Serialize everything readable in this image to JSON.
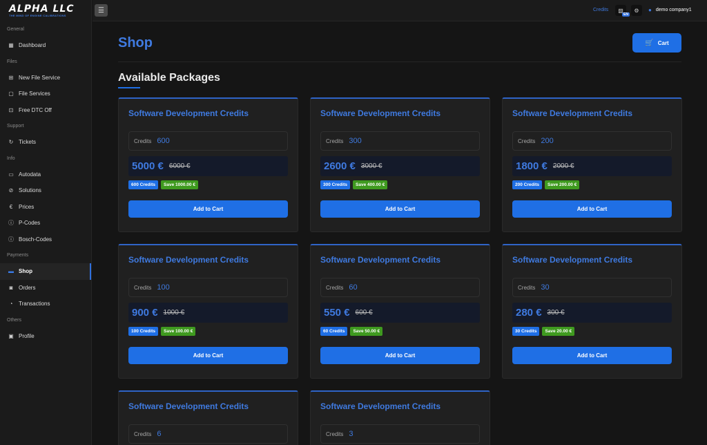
{
  "brand": {
    "name": "ALPHA LLC",
    "tagline": "THE MIND OF ENGINE CALIBRATIONS"
  },
  "topbar": {
    "menu_icon": "menu-icon",
    "credits_label": "Credits",
    "language": "EN",
    "user_name": "demo company1"
  },
  "sidebar": {
    "sections": [
      {
        "title": "General",
        "items": [
          {
            "label": "Dashboard",
            "icon": "dashboard-icon"
          }
        ]
      },
      {
        "title": "Files",
        "items": [
          {
            "label": "New File Service",
            "icon": "new-file-icon"
          },
          {
            "label": "File Services",
            "icon": "file-icon"
          },
          {
            "label": "Free DTC Off",
            "icon": "gift-icon"
          }
        ]
      },
      {
        "title": "Support",
        "items": [
          {
            "label": "Tickets",
            "icon": "ticket-icon"
          }
        ]
      },
      {
        "title": "Info",
        "items": [
          {
            "label": "Autodata",
            "icon": "data-icon"
          },
          {
            "label": "Solutions",
            "icon": "check-icon"
          },
          {
            "label": "Prices",
            "icon": "euro-icon"
          },
          {
            "label": "P-Codes",
            "icon": "info-icon"
          },
          {
            "label": "Bosch-Codes",
            "icon": "info-icon"
          }
        ]
      },
      {
        "title": "Payments",
        "items": [
          {
            "label": "Shop",
            "icon": "shop-icon",
            "active": true
          },
          {
            "label": "Orders",
            "icon": "orders-icon"
          },
          {
            "label": "Transactions",
            "icon": "transactions-icon"
          }
        ]
      },
      {
        "title": "Others",
        "items": [
          {
            "label": "Profile",
            "icon": "profile-icon"
          }
        ]
      }
    ]
  },
  "page": {
    "title": "Shop",
    "cart_label": "Cart",
    "section_title": "Available Packages"
  },
  "packages": [
    {
      "title": "Software Development Credits",
      "credits_label": "Credits",
      "credits": "600",
      "price": "5000 €",
      "old_price": "6000 €",
      "badge_credits": "600 Credits",
      "badge_save": "Save 1000.00 €",
      "button": "Add to Cart"
    },
    {
      "title": "Software Development Credits",
      "credits_label": "Credits",
      "credits": "300",
      "price": "2600 €",
      "old_price": "3000 €",
      "badge_credits": "300 Credits",
      "badge_save": "Save 400.00 €",
      "button": "Add to Cart"
    },
    {
      "title": "Software Development Credits",
      "credits_label": "Credits",
      "credits": "200",
      "price": "1800 €",
      "old_price": "2000 €",
      "badge_credits": "200 Credits",
      "badge_save": "Save 200.00 €",
      "button": "Add to Cart"
    },
    {
      "title": "Software Development Credits",
      "credits_label": "Credits",
      "credits": "100",
      "price": "900 €",
      "old_price": "1000 €",
      "badge_credits": "100 Credits",
      "badge_save": "Save 100.00 €",
      "button": "Add to Cart"
    },
    {
      "title": "Software Development Credits",
      "credits_label": "Credits",
      "credits": "60",
      "price": "550 €",
      "old_price": "600 €",
      "badge_credits": "60 Credits",
      "badge_save": "Save 50.00 €",
      "button": "Add to Cart"
    },
    {
      "title": "Software Development Credits",
      "credits_label": "Credits",
      "credits": "30",
      "price": "280 €",
      "old_price": "300 €",
      "badge_credits": "30 Credits",
      "badge_save": "Save 20.00 €",
      "button": "Add to Cart"
    },
    {
      "title": "Software Development Credits",
      "credits_label": "Credits",
      "credits": "6"
    },
    {
      "title": "Software Development Credits",
      "credits_label": "Credits",
      "credits": "3"
    }
  ]
}
